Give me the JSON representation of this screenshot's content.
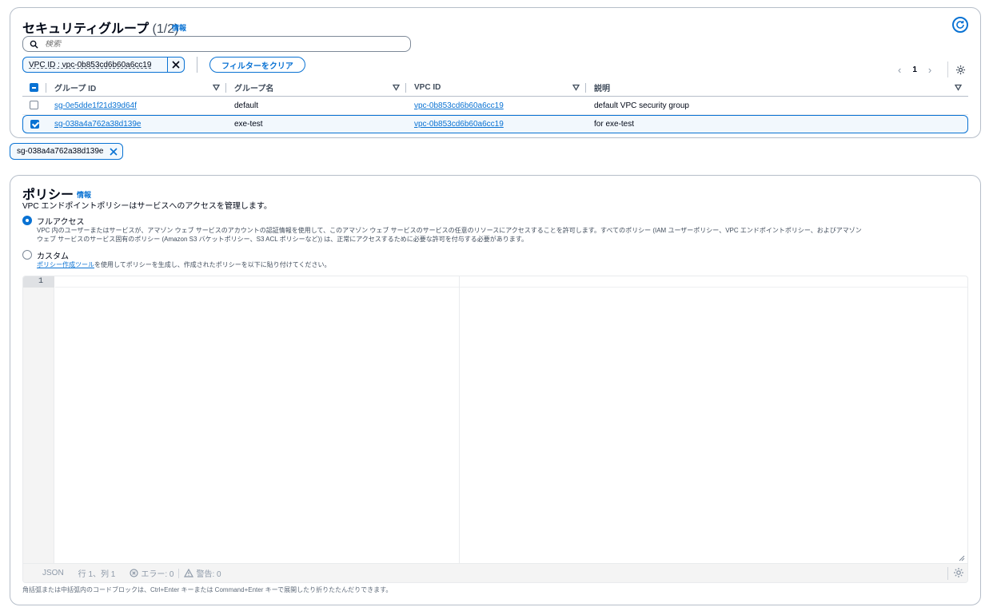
{
  "security_groups": {
    "title": "セキュリティグループ",
    "count": "(1/2)",
    "info_label": "情報",
    "search_placeholder": "検索",
    "filter_token": "VPC ID : vpc-0b853cd6b60a6cc19",
    "clear_filter_label": "フィルターをクリア",
    "page_number": "1",
    "columns": [
      "グループ ID",
      "グループ名",
      "VPC ID",
      "説明"
    ],
    "rows": [
      {
        "group_id": "sg-0e5dde1f21d39d64f",
        "group_name": "default",
        "vpc_id": "vpc-0b853cd6b60a6cc19",
        "description": "default VPC security group",
        "selected": false
      },
      {
        "group_id": "sg-038a4a762a38d139e",
        "group_name": "exe-test",
        "vpc_id": "vpc-0b853cd6b60a6cc19",
        "description": "for exe-test",
        "selected": true
      }
    ]
  },
  "selected_token": "sg-038a4a762a38d139e",
  "policy": {
    "title": "ポリシー",
    "info_label": "情報",
    "description": "VPC エンドポイントポリシーはサービスへのアクセスを管理します。",
    "options": [
      {
        "label": "フルアクセス",
        "checked": true,
        "description_line1": "VPC 内のユーザーまたはサービスが、アマゾン ウェブ サービスのアカウントの認証情報を使用して、このアマゾン ウェブ サービスのサービスの任意のリソースにアクセスすることを許可します。すべてのポリシー (IAM ユーザーポリシー、VPC エンドポイントポリシー、およびアマゾン",
        "description_line2": "ウェブ サービスのサービス固有のポリシー (Amazon S3 バケットポリシー、S3 ACL ポリシーなど)) は、正常にアクセスするために必要な許可を付与する必要があります。"
      },
      {
        "label": "カスタム",
        "checked": false,
        "link_text": "ポリシー作成ツール",
        "description_rest": "を使用してポリシーを生成し、作成されたポリシーを以下に貼り付けてください。"
      }
    ],
    "editor": {
      "line_number": "1",
      "language": "JSON",
      "cursor": "行 1、列 1",
      "errors": "エラー: 0",
      "warnings": "警告: 0"
    },
    "footer_note": "角括弧または中括弧内のコードブロックは、Ctrl+Enter キーまたは Command+Enter キーで展開したり折りたたんだりできます。"
  }
}
